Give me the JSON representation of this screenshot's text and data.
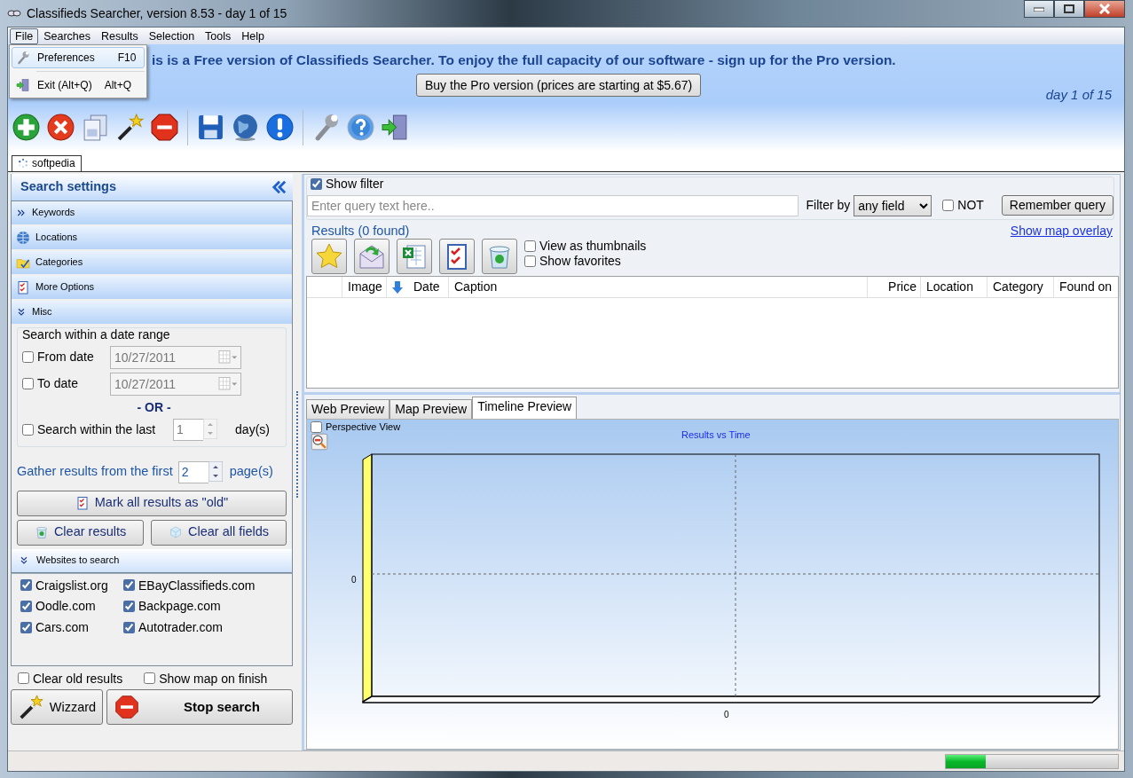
{
  "window": {
    "title": "Classifieds Searcher, version 8.53 - day 1 of 15"
  },
  "menu_bar": [
    {
      "label": "File",
      "selected": true
    },
    {
      "label": "Searches",
      "selected": false
    },
    {
      "label": "Results",
      "selected": false
    },
    {
      "label": "Selection",
      "selected": false
    },
    {
      "label": "Tools",
      "selected": false
    },
    {
      "label": "Help",
      "selected": false
    }
  ],
  "file_menu": [
    {
      "label": "Preferences",
      "shortcut": "F10",
      "selected": true
    },
    {
      "label": "Exit (Alt+Q)",
      "shortcut": "Alt+Q",
      "selected": false
    }
  ],
  "banner": {
    "message": "is is a Free version of Classifieds Searcher. To enjoy the full capacity of our software - sign up for the Pro version.",
    "button": "Buy the Pro version (prices are starting at $5.67)",
    "trial": "day 1 of 15"
  },
  "document_tabs": [
    {
      "label": "softpedia",
      "selected": true
    }
  ],
  "search_settings": {
    "title": "Search settings",
    "sections": [
      {
        "label": "Keywords",
        "expanded": false
      },
      {
        "label": "Locations",
        "expanded": false
      },
      {
        "label": "Categories",
        "expanded": false
      },
      {
        "label": "More Options",
        "expanded": false
      },
      {
        "label": "Misc",
        "expanded": true
      }
    ],
    "date_range": {
      "title": "Search within a date range",
      "rows": [
        {
          "label": "From date",
          "checked": false,
          "value": "10/27/2011"
        },
        {
          "label": "To date",
          "checked": false,
          "value": "10/27/2011"
        }
      ],
      "or": "- OR -",
      "last": {
        "label": "Search within the last",
        "checked": false,
        "value": "1",
        "unit": "day(s)"
      }
    },
    "gather": {
      "label": "Gather results from the first",
      "value": "2",
      "unit": "page(s)"
    },
    "mark_old_button": "Mark all results as \"old\"",
    "clear_buttons": [
      "Clear results",
      "Clear all fields"
    ],
    "websites": {
      "title": "Websites to search",
      "expanded": true,
      "items": [
        {
          "label": "Craigslist.org",
          "checked": true
        },
        {
          "label": "EBayClassifieds.com",
          "checked": true
        },
        {
          "label": "Oodle.com",
          "checked": true
        },
        {
          "label": "Backpage.com",
          "checked": true
        },
        {
          "label": "Cars.com",
          "checked": true
        },
        {
          "label": "Autotrader.com",
          "checked": true
        }
      ]
    },
    "options": [
      {
        "label": "Clear old results",
        "checked": false
      },
      {
        "label": "Show map on finish",
        "checked": false
      }
    ],
    "wizard_button": "Wizzard",
    "stop_button": "Stop search"
  },
  "filter": {
    "show_filter": {
      "label": "Show filter",
      "checked": true
    },
    "placeholder": "Enter query text here..",
    "filter_by_label": "Filter by",
    "filter_by": "any field",
    "not": {
      "label": "NOT",
      "checked": false
    },
    "remember_button": "Remember query"
  },
  "results": {
    "title": "Results (0 found)",
    "map_link": "Show map overlay",
    "view_options": [
      {
        "label": "View as thumbnails",
        "checked": false
      },
      {
        "label": "Show favorites",
        "checked": false
      }
    ],
    "columns": [
      {
        "label": "Image",
        "sorted": false
      },
      {
        "label": "Date",
        "sorted": true
      },
      {
        "label": "Caption",
        "sorted": false
      },
      {
        "label": "Price",
        "sorted": false
      },
      {
        "label": "Location",
        "sorted": false
      },
      {
        "label": "Category",
        "sorted": false
      },
      {
        "label": "Found on",
        "sorted": false
      }
    ]
  },
  "preview_tabs": [
    {
      "label": "Web Preview",
      "selected": false
    },
    {
      "label": "Map Preview",
      "selected": false
    },
    {
      "label": "Timeline Preview",
      "selected": true
    }
  ],
  "timeline": {
    "perspective": {
      "label": "Perspective View",
      "checked": false
    },
    "chart_title": "Results vs Time",
    "y_tick": "0",
    "x_tick": "0"
  },
  "status_bar": {
    "progress": {
      "level": 0.23
    }
  }
}
